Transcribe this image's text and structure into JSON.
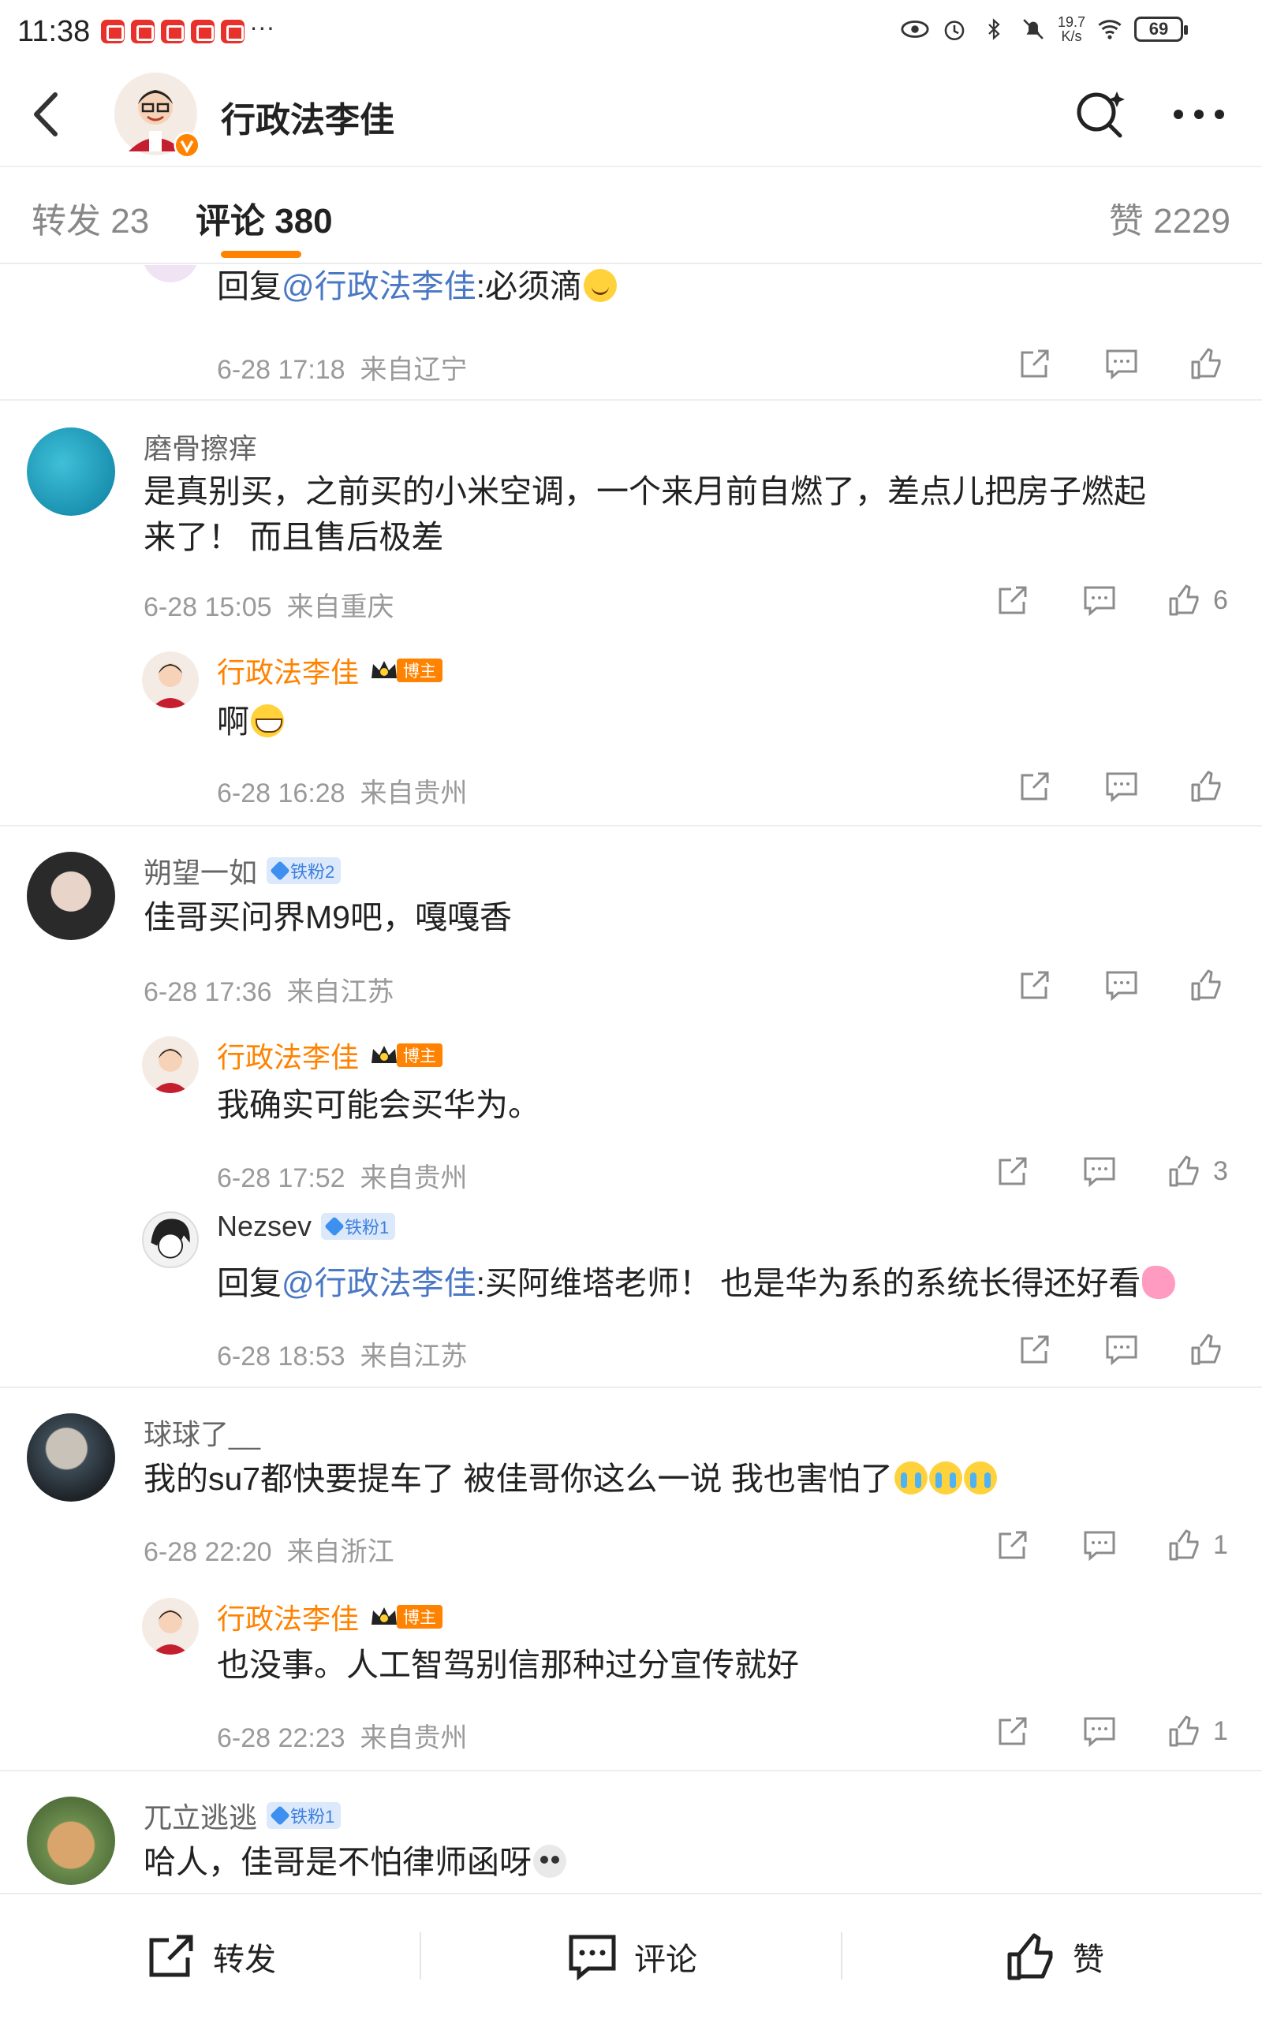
{
  "status_bar": {
    "time": "11:38",
    "net_speed_top": "19.7",
    "net_speed_bottom": "K/s",
    "battery": "69",
    "more": "···"
  },
  "header": {
    "title": "行政法李佳"
  },
  "tabs": {
    "forward": "转发 23",
    "comment": "评论 380",
    "like": "赞 2229"
  },
  "comments": [
    {
      "text_prefix": "回复",
      "mention": "@行政法李佳",
      "text": ":必须滴",
      "time": "6-28 17:18",
      "location": "来自辽宁",
      "likes": ""
    },
    {
      "user": "磨骨擦痒",
      "text_line1": "是真别买，之前买的小米空调，一个来月前自燃了，差点儿把房子燃起",
      "text_line2": "来了！  而且售后极差",
      "time": "6-28 15:05",
      "location": "来自重庆",
      "likes": "6"
    },
    {
      "user": "行政法李佳",
      "badge": "博主",
      "text": "啊",
      "time": "6-28 16:28",
      "location": "来自贵州",
      "likes": ""
    },
    {
      "user": "朔望一如",
      "badge": "铁粉2",
      "text": "佳哥买问界M9吧，嘎嘎香",
      "time": "6-28 17:36",
      "location": "来自江苏",
      "likes": ""
    },
    {
      "user": "行政法李佳",
      "badge": "博主",
      "text": "我确实可能会买华为。",
      "time": "6-28 17:52",
      "location": "来自贵州",
      "likes": "3"
    },
    {
      "user": "Nezsev",
      "badge": "铁粉1",
      "text_prefix": "回复",
      "mention": "@行政法李佳",
      "text": ":买阿维塔老师！ 也是华为系的系统长得还好看",
      "time": "6-28 18:53",
      "location": "来自江苏",
      "likes": ""
    },
    {
      "user": "球球了__",
      "text": "我的su7都快要提车了 被佳哥你这么一说 我也害怕了",
      "time": "6-28 22:20",
      "location": "来自浙江",
      "likes": "1"
    },
    {
      "user": "行政法李佳",
      "badge": "博主",
      "text": "也没事。人工智驾别信那种过分宣传就好",
      "time": "6-28 22:23",
      "location": "来自贵州",
      "likes": "1"
    },
    {
      "user": "兀立逃逃",
      "badge": "铁粉1",
      "text": "哈人，佳哥是不怕律师函呀"
    }
  ],
  "bottom_bar": {
    "forward": "转发",
    "comment": "评论",
    "like": "赞"
  },
  "colors": {
    "accent": "#ff8200",
    "mention": "#4a78c4",
    "fan_badge": "#3d7fe0"
  }
}
